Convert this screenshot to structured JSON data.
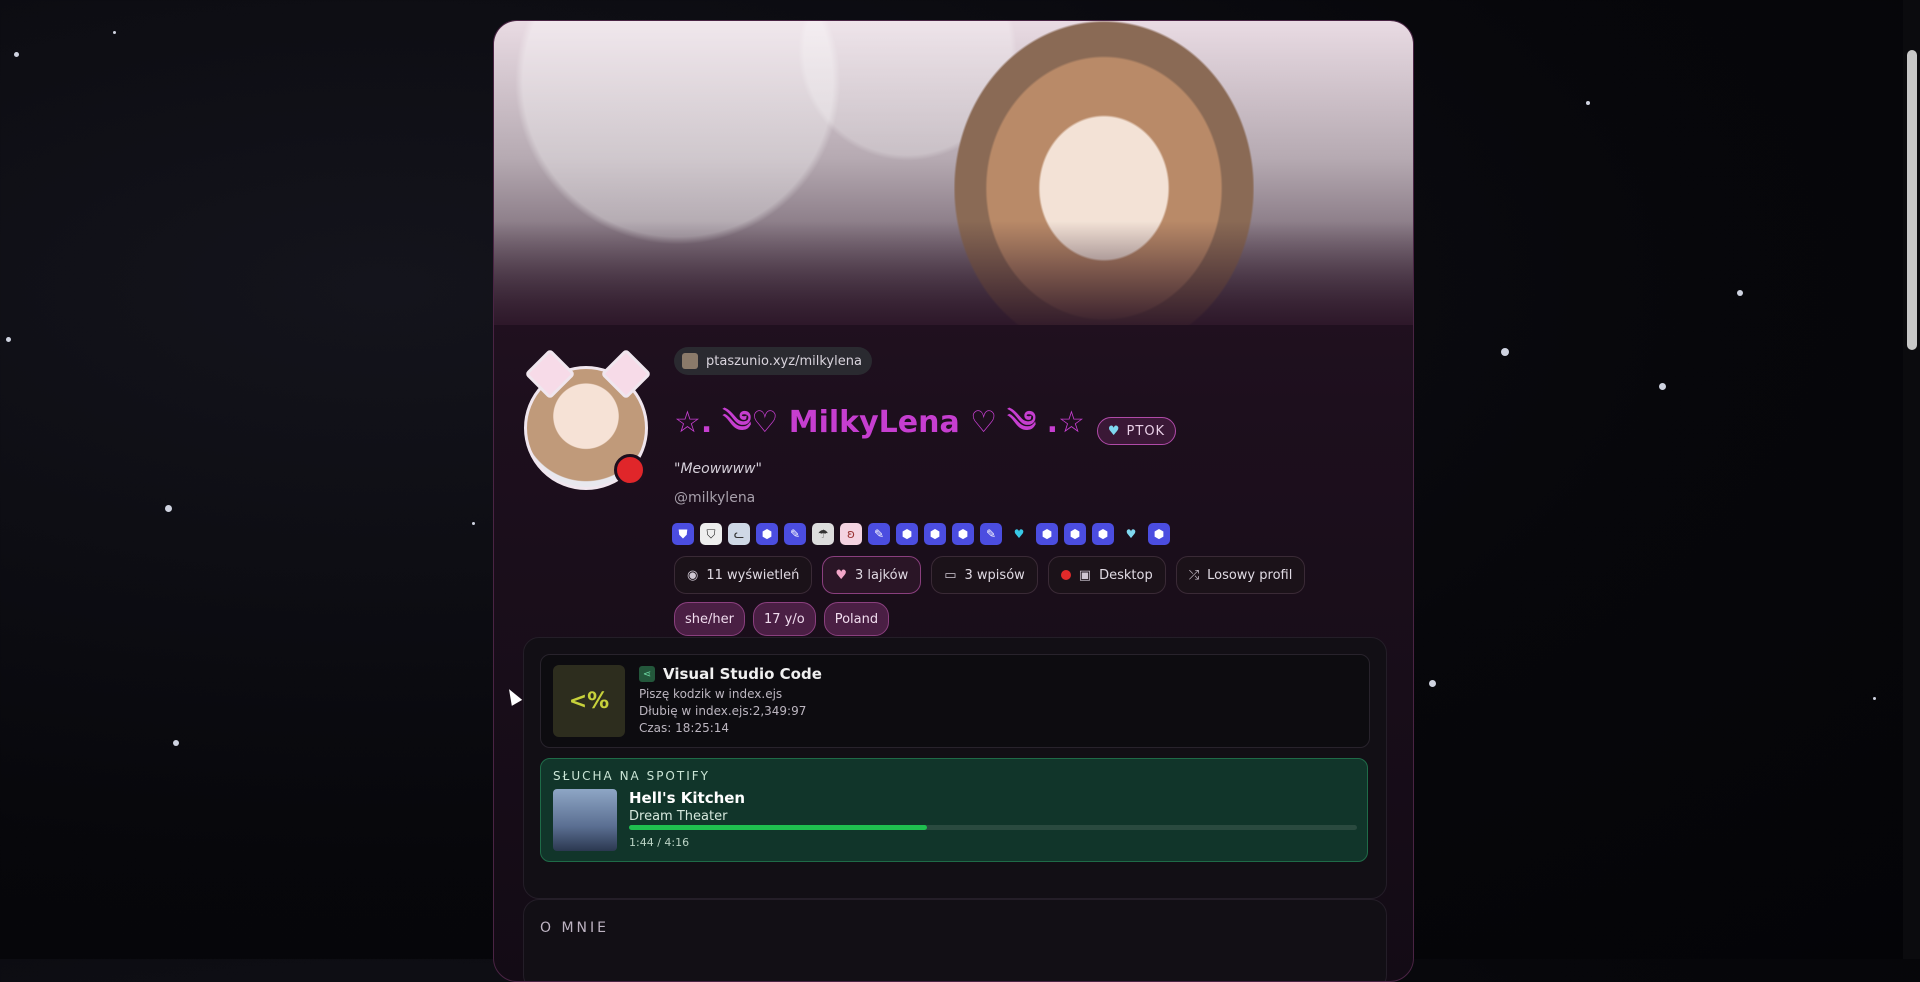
{
  "profile": {
    "url": "ptaszunio.xyz/milkylena",
    "display_name": "☆. ༄♡ MilkyLena ♡ ༄ .☆",
    "tag": "PTOK",
    "quote": "\"Meowwww\"",
    "handle": "@milkylena",
    "badges": [
      "shield-icon",
      "shield-icon",
      "cat-icon",
      "hex-icon",
      "pencil-icon",
      "mushroom-icon",
      "bunny-icon",
      "pencil-icon",
      "hex-icon",
      "hex-icon",
      "hex-icon",
      "pencil-icon",
      "heart-icon",
      "hex-icon",
      "hex-icon",
      "hex-icon",
      "heart-icon",
      "hex-icon"
    ]
  },
  "stats": {
    "views": "11 wyświetleń",
    "likes": "3 lajków",
    "posts": "3 wpisów",
    "device": "Desktop",
    "random": "Losowy profil"
  },
  "pills": [
    "she/her",
    "17 y/o",
    "Poland"
  ],
  "activity": {
    "app_name": "Visual Studio Code",
    "tile_text": "<%",
    "line1": "Piszę kodzik w index.ejs",
    "line2": "Dłubię w index.ejs:2,349:97",
    "line3": "Czas: 18:25:14"
  },
  "spotify": {
    "header": "SŁUCHA NA SPOTIFY",
    "track": "Hell's Kitchen",
    "artist": "Dream Theater",
    "time": "1:44 / 4:16",
    "progress": 0.41
  },
  "about": {
    "header": "O MNIE"
  },
  "colors": {
    "accent": "#c63ed0",
    "spotify": "#1fbf4f",
    "status": "#e0262a"
  }
}
